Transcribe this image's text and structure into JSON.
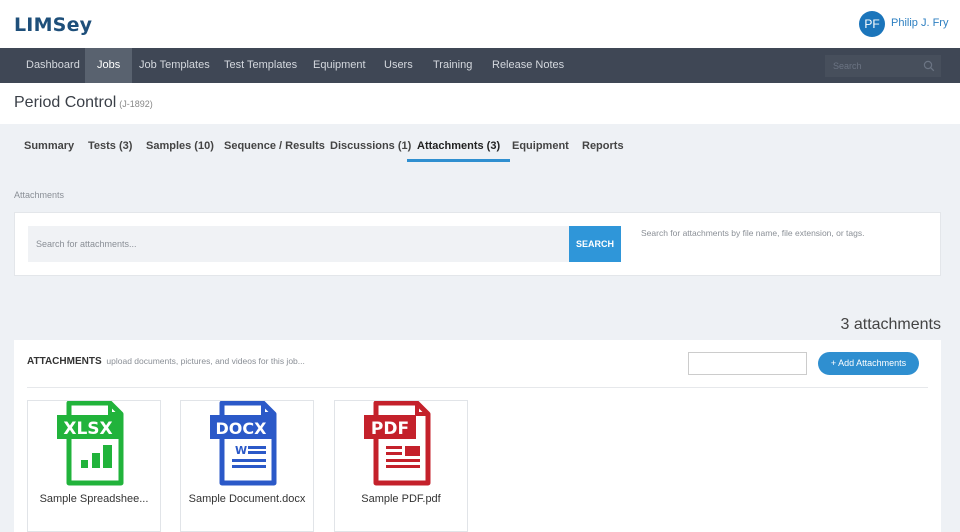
{
  "app": {
    "logo": "LIMSey"
  },
  "user": {
    "initials": "PF",
    "name": "Philip J. Fry"
  },
  "nav": {
    "items": [
      {
        "label": "Dashboard"
      },
      {
        "label": "Jobs"
      },
      {
        "label": "Job Templates"
      },
      {
        "label": "Test Templates"
      },
      {
        "label": "Equipment"
      },
      {
        "label": "Users"
      },
      {
        "label": "Training"
      },
      {
        "label": "Release Notes"
      }
    ],
    "active": "Jobs",
    "search_placeholder": "Search"
  },
  "page": {
    "title": "Period Control",
    "code": "(J-1892)"
  },
  "tabs": {
    "items": [
      {
        "label": "Summary"
      },
      {
        "label": "Tests (3)"
      },
      {
        "label": "Samples (10)"
      },
      {
        "label": "Sequence / Results"
      },
      {
        "label": "Discussions (1)"
      },
      {
        "label": "Attachments (3)"
      },
      {
        "label": "Equipment"
      },
      {
        "label": "Reports"
      }
    ],
    "active": "Attachments (3)"
  },
  "attachments_search": {
    "section_label": "Attachments",
    "placeholder": "Search for attachments...",
    "button_label": "SEARCH",
    "help_text": "Search for attachments by file name, file extension, or tags."
  },
  "attachments": {
    "count_text": "3 attachments",
    "heading": "ATTACHMENTS",
    "subheading": "upload documents, pictures, and videos for this job...",
    "add_button_label": "+ Add Attachments",
    "files": [
      {
        "name": "Sample Spreadshee...",
        "type": "XLSX",
        "color": "#21b33b",
        "icon": "spreadsheet-file-icon"
      },
      {
        "name": "Sample Document.docx",
        "type": "DOCX",
        "color": "#2b59c8",
        "icon": "document-file-icon"
      },
      {
        "name": "Sample PDF.pdf",
        "type": "PDF",
        "color": "#c4212b",
        "icon": "pdf-file-icon"
      }
    ]
  },
  "colors": {
    "accent": "#2f8fd0",
    "navbar": "#3f4755",
    "brand": "#1e4f7a"
  }
}
